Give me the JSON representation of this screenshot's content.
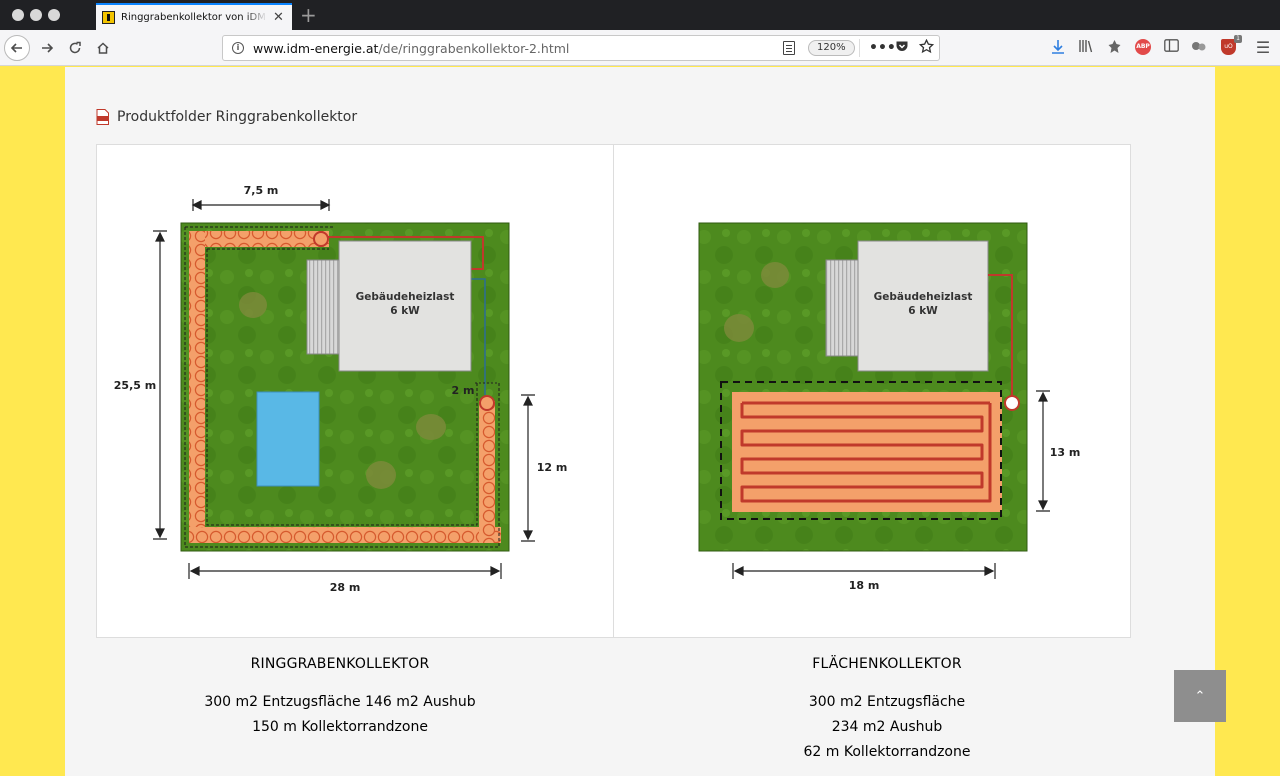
{
  "browser": {
    "tab_title": "Ringgrabenkollektor von iDM | iDM",
    "tab_close": "✕",
    "new_tab": "+",
    "url_host": "www.idm-energie.at",
    "url_path": "/de/ringgrabenkollektor-2.html",
    "zoom": "120%",
    "adblock_label": "ABP",
    "ublock_count": "1",
    "icons": [
      "back-arrow-icon",
      "forward-arrow-icon",
      "reload-icon",
      "home-icon",
      "info-icon",
      "reader-view-icon",
      "more-icon",
      "pocket-icon",
      "bookmark-star-icon",
      "download-icon",
      "library-icon",
      "extension-icon",
      "adblock-icon",
      "sidebar-icon",
      "extension2-icon",
      "ublock-icon",
      "menu-icon"
    ]
  },
  "page": {
    "pdf_link": "Produktfolder Ringgrabenkollektor",
    "left_figure": {
      "house_label_line1": "Gebäudeheizlast",
      "house_label_line2": "6 kW",
      "dim_top": "7,5 m",
      "dim_left": "25,5 m",
      "dim_gap": "2 m",
      "dim_right": "12 m",
      "dim_bottom": "28 m"
    },
    "right_figure": {
      "house_label_line1": "Gebäudeheizlast",
      "house_label_line2": "6 kW",
      "dim_right": "13 m",
      "dim_bottom": "18 m"
    },
    "captions": {
      "left_title": "RINGGRABENKOLLEKTOR",
      "left_line1": "300 m2 Entzugsfläche 146 m2 Aushub",
      "left_line2": "150 m Kollektorrandzone",
      "right_title": "FLÄCHENKOLLEKTOR",
      "right_line1": "300 m2 Entzugsfläche",
      "right_line2": "234 m2 Aushub",
      "right_line3": "62 m Kollektorrandzone"
    },
    "scroll_top_label": "⌃"
  },
  "colors": {
    "side_yellow": "#ffe850",
    "grass": "#4f8a1f",
    "collector_orange": "#f4a06a",
    "pipe_red": "#c0392b",
    "pool_blue": "#59b8e6"
  }
}
